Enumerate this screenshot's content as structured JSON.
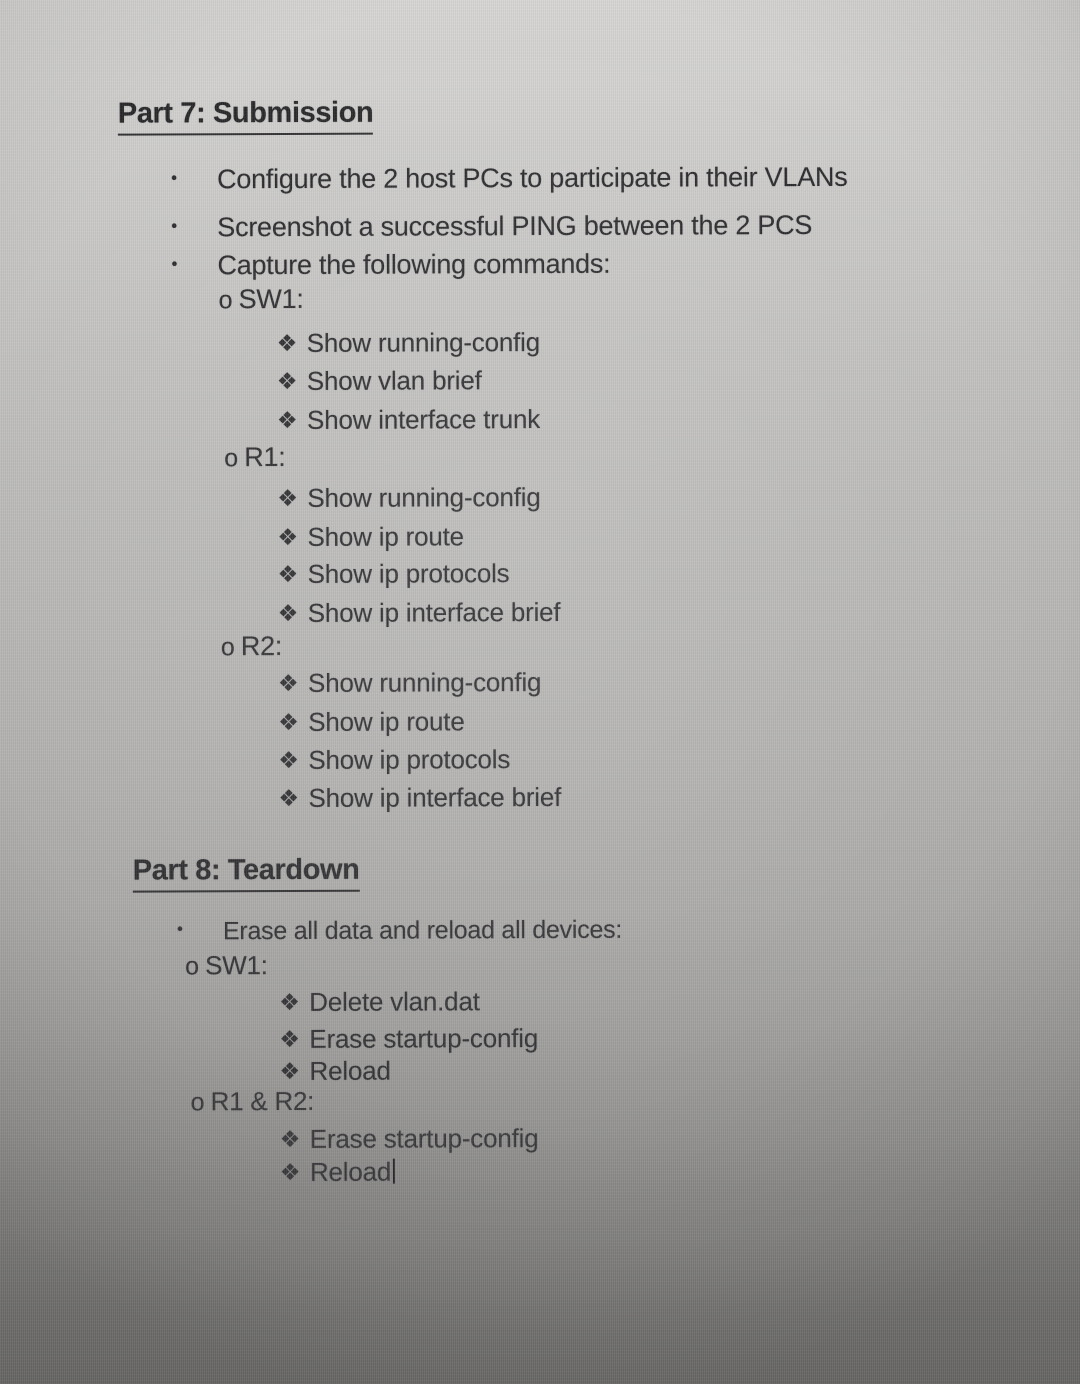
{
  "document": {
    "sections": [
      {
        "heading": "Part 7: Submission",
        "bullets": [
          "Configure the 2 host PCs to participate in their VLANs",
          "Screenshot a successful PING between the 2 PCS",
          "Capture the following commands:"
        ],
        "devices": [
          {
            "label": "SW1:",
            "commands": [
              "Show running-config",
              "Show vlan brief",
              "Show interface trunk"
            ]
          },
          {
            "label": "R1:",
            "commands": [
              "Show running-config",
              "Show ip route",
              "Show ip protocols",
              "Show ip interface brief"
            ]
          },
          {
            "label": "R2:",
            "commands": [
              "Show running-config",
              "Show ip route",
              "Show ip protocols",
              "Show ip interface brief"
            ]
          }
        ]
      },
      {
        "heading": "Part 8: Teardown",
        "bullets": [
          "Erase all data and reload all devices:"
        ],
        "devices": [
          {
            "label": "SW1:",
            "commands": [
              "Delete vlan.dat",
              "Erase startup-config",
              "Reload"
            ]
          },
          {
            "label": "R1 & R2:",
            "commands": [
              "Erase startup-config",
              "Reload"
            ]
          }
        ]
      }
    ],
    "markers": {
      "bullet": "•",
      "sub": "o",
      "floret": "❖"
    }
  }
}
